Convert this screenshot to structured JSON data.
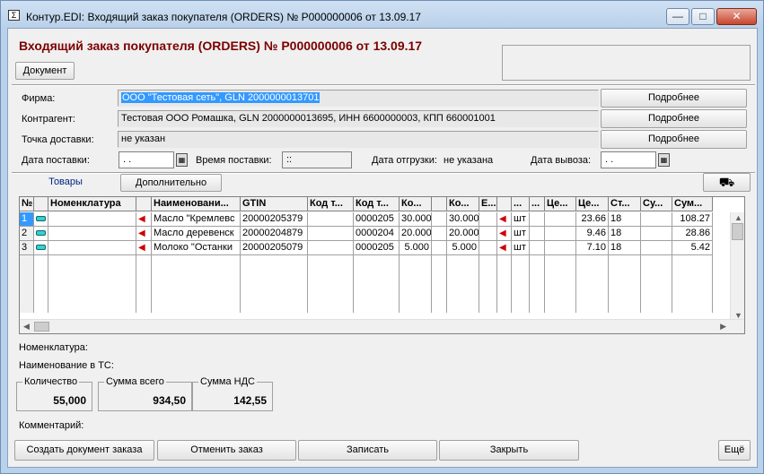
{
  "window": {
    "title": "Контур.EDI: Входящий заказ покупателя (ORDERS) № P000000006 от 13.09.17",
    "minimize": "—",
    "maximize": "□",
    "close": "✕"
  },
  "header": {
    "title": "Входящий заказ покупателя (ORDERS) № P000000006 от 13.09.17",
    "document_button": "Документ"
  },
  "form": {
    "firm_label": "Фирма:",
    "firm_value": "ООО \"Тестовая сеть\", GLN 2000000013701",
    "contractor_label": "Контрагент:",
    "contractor_value": "Тестовая ООО Ромашка, GLN 2000000013695, ИНН 6600000003, КПП 660001001",
    "delivery_point_label": "Точка доставки:",
    "delivery_point_value": "не указан",
    "details_button": "Подробнее",
    "delivery_date_label": "Дата поставки:",
    "delivery_date_value": ". .",
    "delivery_time_label": "Время поставки:",
    "delivery_time_value": "::",
    "shipping_date_label": "Дата отгрузки:",
    "shipping_date_value": "не указана",
    "pickup_date_label": "Дата вывоза:",
    "pickup_date_value": ". ."
  },
  "tabs": [
    {
      "label": "Товары",
      "active": true
    },
    {
      "label": "Дополнительно",
      "active": false
    }
  ],
  "grid": {
    "columns": [
      "№",
      "",
      "Номенклатура",
      "",
      "Наименовани...",
      "GTIN",
      "Код т...",
      "Код т...",
      "Ко...",
      "",
      "Ко...",
      "Е...",
      "",
      "...",
      "...",
      "Це...",
      "Це...",
      "Ст...",
      "Су...",
      "Сум..."
    ],
    "rows": [
      {
        "n": "1",
        "name": "Масло \"Кремлевс",
        "gtin": "20000205379",
        "code2": "0000205",
        "qty1": "30.000",
        "qty2": "30.000",
        "unit": "шт",
        "price": "23.66",
        "rate": "18",
        "sum": "108.27",
        "selected": true
      },
      {
        "n": "2",
        "name": "Масло деревенск",
        "gtin": "20000204879",
        "code2": "0000204",
        "qty1": "20.000",
        "qty2": "20.000",
        "unit": "шт",
        "price": "9.46",
        "rate": "18",
        "sum": "28.86",
        "selected": false
      },
      {
        "n": "3",
        "name": "Молоко \"Останки",
        "gtin": "20000205079",
        "code2": "0000205",
        "qty1": "5.000",
        "qty2": "5.000",
        "unit": "шт",
        "price": "7.10",
        "rate": "18",
        "sum": "5.42",
        "selected": false
      }
    ]
  },
  "info": {
    "nomenclature_label": "Номенклатура:",
    "ts_name_label": "Наименование в ТС:",
    "comment_label": "Комментарий:"
  },
  "totals": {
    "qty_label": "Количество",
    "qty_value": "55,000",
    "sum_label": "Сумма всего",
    "sum_value": "934,50",
    "vat_label": "Сумма НДС",
    "vat_value": "142,55"
  },
  "footer": {
    "create_order": "Создать документ заказа",
    "cancel_order": "Отменить заказ",
    "save": "Записать",
    "close": "Закрыть",
    "more": "Ещё"
  }
}
